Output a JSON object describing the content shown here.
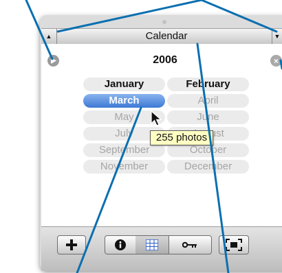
{
  "window": {
    "title": "Calendar",
    "left_arrow": "▲",
    "right_arrow": "▼"
  },
  "calendar": {
    "year": "2006",
    "months": [
      {
        "label": "January",
        "state": "active"
      },
      {
        "label": "February",
        "state": "active"
      },
      {
        "label": "March",
        "state": "selected"
      },
      {
        "label": "April",
        "state": "dim"
      },
      {
        "label": "May",
        "state": "dim"
      },
      {
        "label": "June",
        "state": "dim"
      },
      {
        "label": "July",
        "state": "dim"
      },
      {
        "label": "August",
        "state": "dim"
      },
      {
        "label": "September",
        "state": "dim"
      },
      {
        "label": "October",
        "state": "dim"
      },
      {
        "label": "November",
        "state": "dim"
      },
      {
        "label": "December",
        "state": "dim"
      }
    ],
    "tooltip": "255 photos"
  },
  "toolbar": {
    "buttons": [
      "add-icon",
      "info-icon",
      "calendar-icon",
      "keyword-icon",
      "full-screen-icon"
    ]
  },
  "colors": {
    "callout": "#0a6fb0",
    "selection": "#3d78d4",
    "tooltip_bg": "#ffffc4"
  }
}
